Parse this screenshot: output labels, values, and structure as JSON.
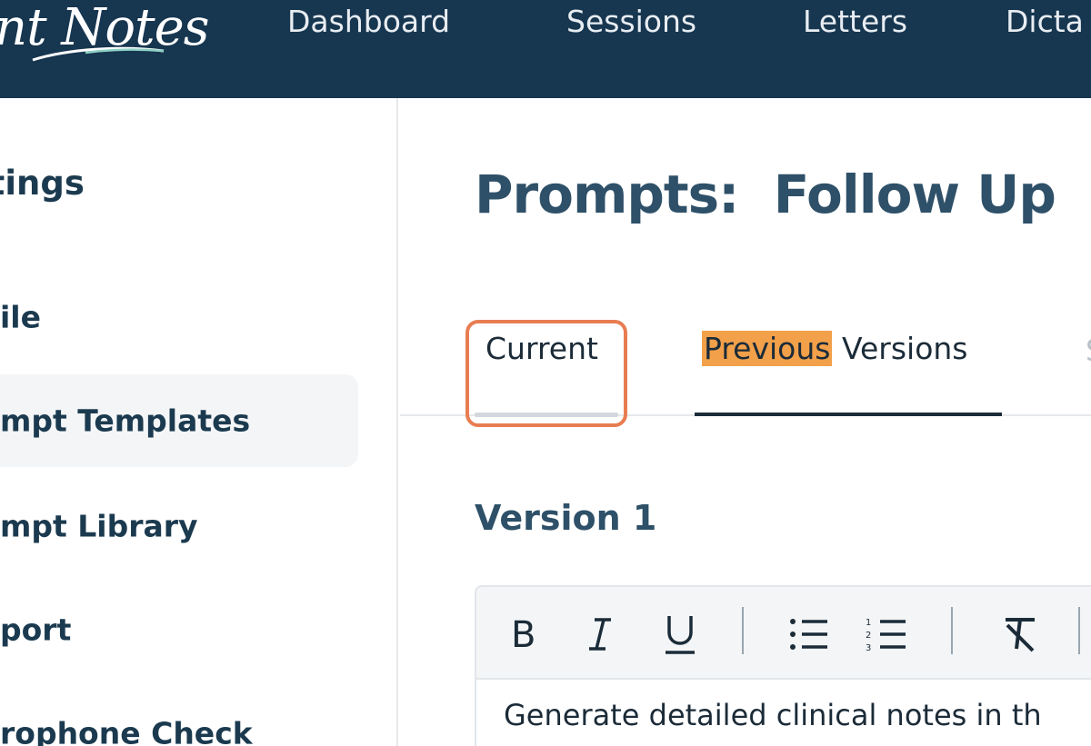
{
  "app": {
    "logo_text": "nt Notes"
  },
  "nav": {
    "items": [
      {
        "label": "Dashboard"
      },
      {
        "label": "Sessions"
      },
      {
        "label": "Letters"
      },
      {
        "label": "Dicta"
      }
    ]
  },
  "sidebar": {
    "heading": "ttings",
    "items": [
      {
        "label": "ile",
        "active": false
      },
      {
        "label": "mpt Templates",
        "active": true
      },
      {
        "label": "mpt Library",
        "active": false
      },
      {
        "label": "port",
        "active": false
      },
      {
        "label": "rophone Check",
        "active": false
      }
    ]
  },
  "main": {
    "title": "Prompts:  Follow Up",
    "tabs": {
      "current": "Current",
      "previous_highlight": "Previous",
      "previous_rest": " Versions",
      "more": "S"
    },
    "version_title": "Version 1",
    "editor": {
      "body_text": "Generate detailed clinical notes in th",
      "toolbar": [
        "bold-icon",
        "italic-icon",
        "underline-icon",
        "bullet-list-icon",
        "numbered-list-icon",
        "clear-format-icon"
      ]
    }
  },
  "colors": {
    "topbar": "#173650",
    "highlight_box": "#e87d52",
    "highlight_text_bg": "#f2a04a",
    "title": "#2e5068"
  }
}
